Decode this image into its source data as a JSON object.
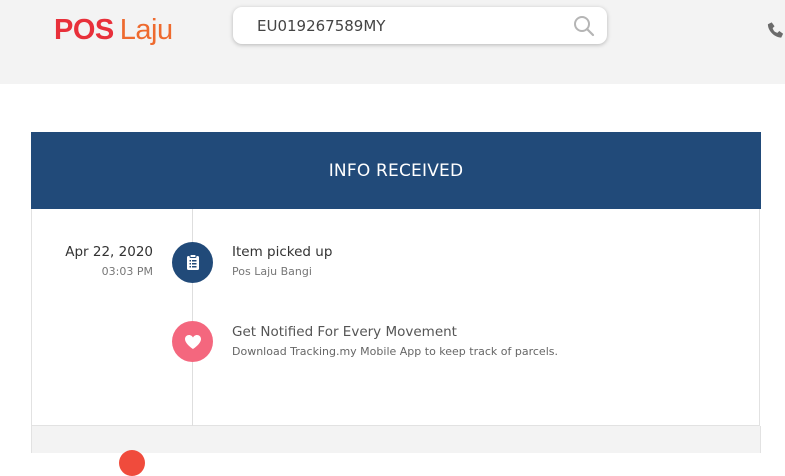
{
  "header": {
    "logo": {
      "pos": "POS",
      "laju": "Laju"
    },
    "search": {
      "value": "EU019267589MY",
      "icon": "search-icon"
    },
    "phone_icon": "phone-icon"
  },
  "tracking": {
    "status_title": "INFO RECEIVED",
    "status_color": "#214a79",
    "events": [
      {
        "date": "Apr 22, 2020",
        "time": "03:03 PM",
        "title": "Item picked up",
        "location": "Pos Laju Bangi",
        "icon": "clipboard-icon"
      }
    ],
    "promo": {
      "title": "Get Notified For Every Movement",
      "subtitle": "Download Tracking.my Mobile App to keep track of parcels.",
      "icon": "heart-icon",
      "color": "#f4677e"
    }
  }
}
